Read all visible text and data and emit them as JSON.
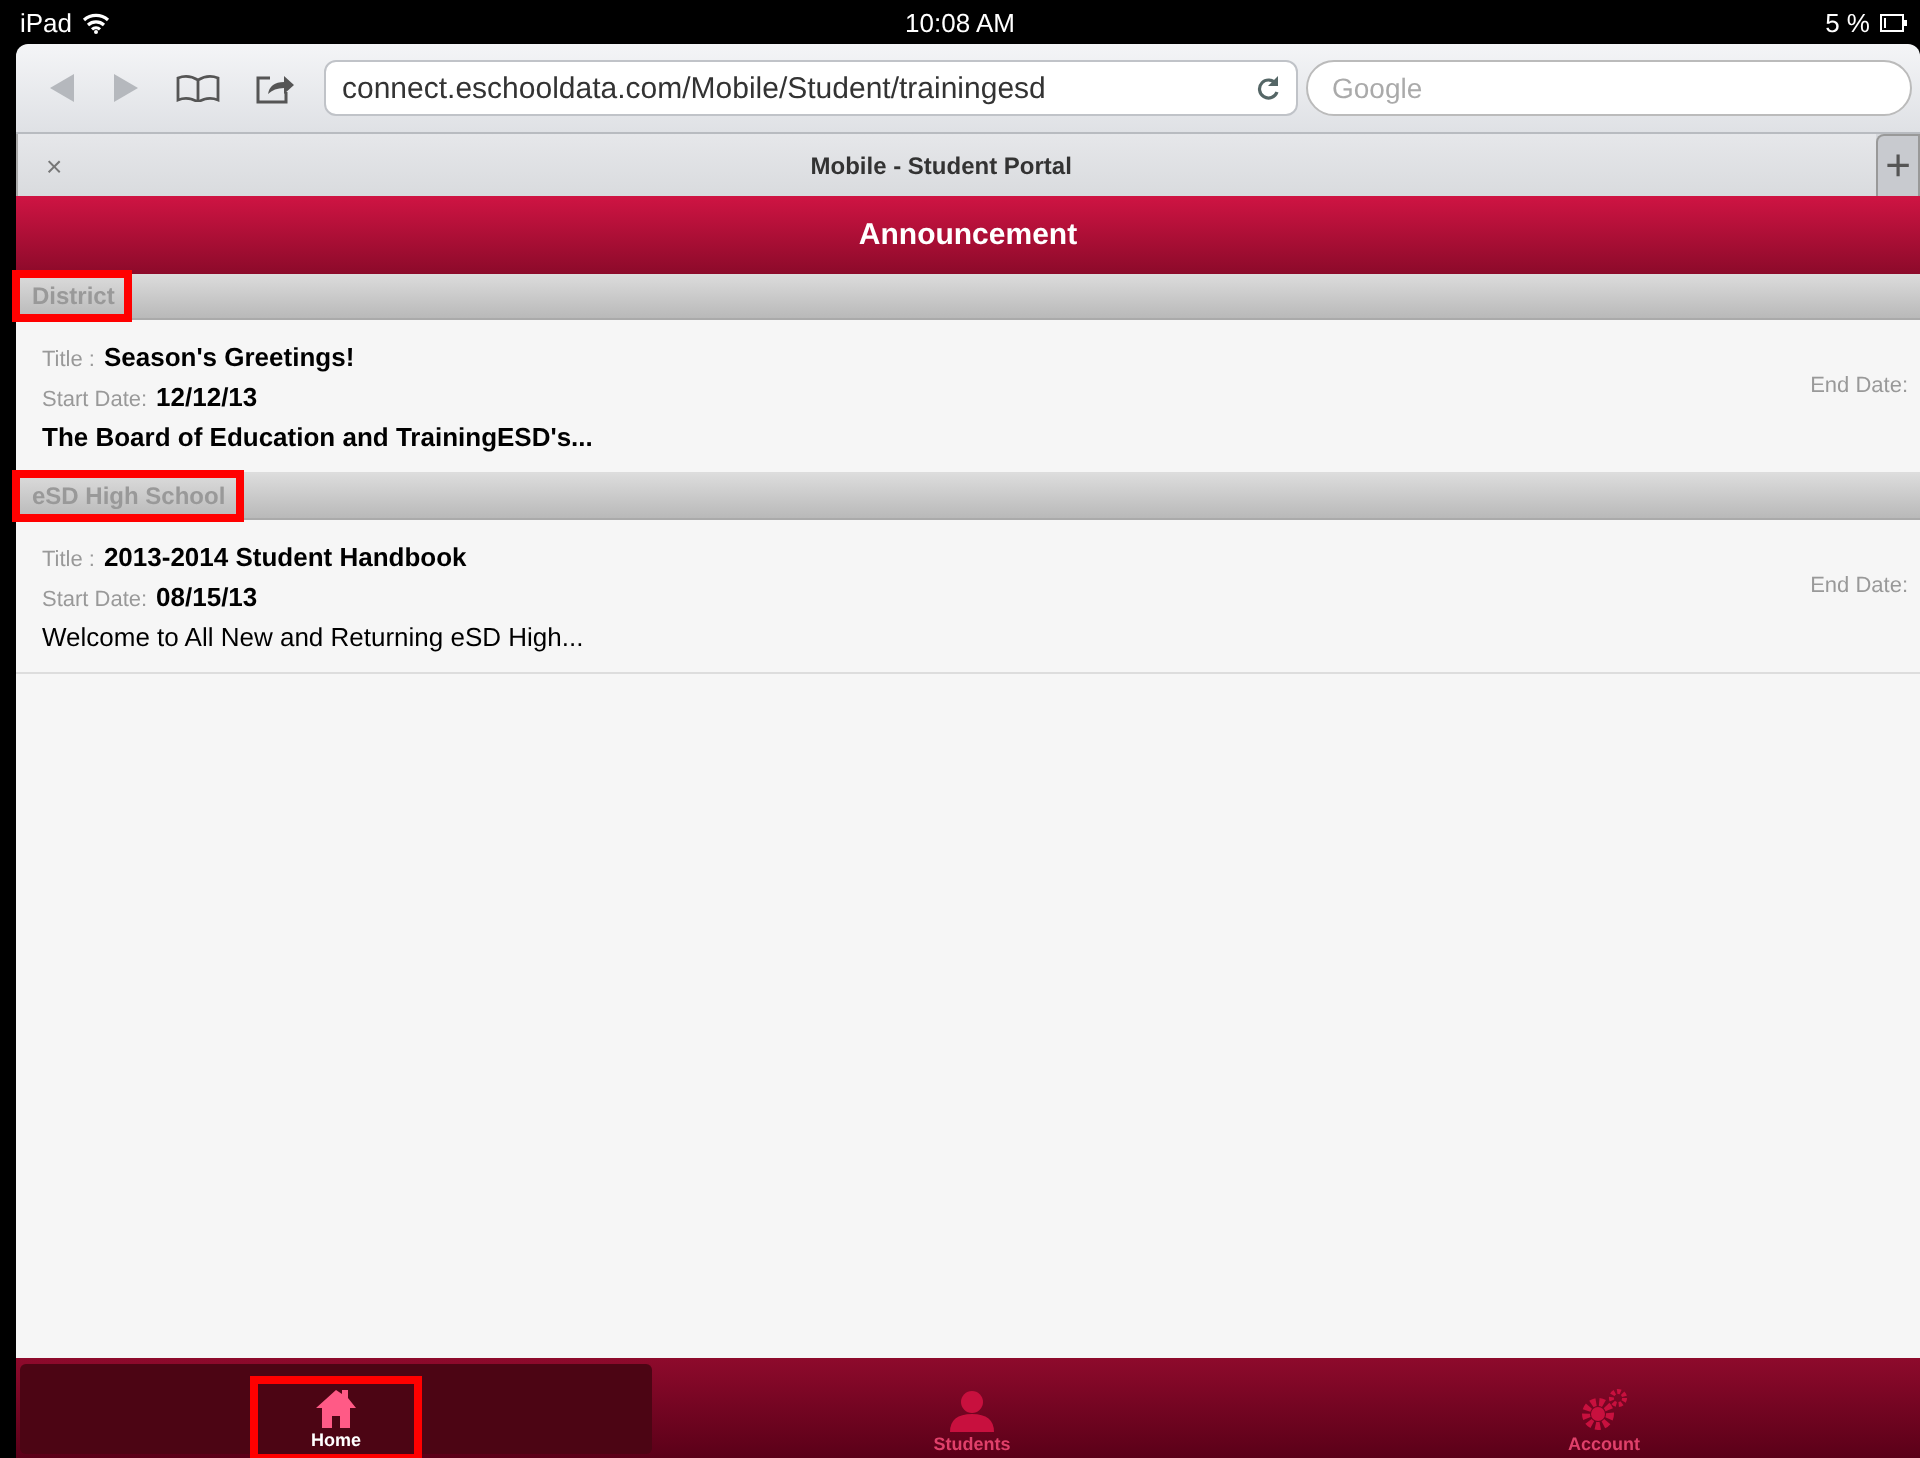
{
  "status_bar": {
    "device": "iPad",
    "time": "10:08 AM",
    "battery": "5 %"
  },
  "browser": {
    "url": "connect.eschooldata.com/Mobile/Student/trainingesd",
    "search": {
      "placeholder": "Google"
    },
    "tab_close": "×",
    "tab_title": "Mobile - Student Portal",
    "new_tab": "+"
  },
  "header": {
    "title": "Announcement"
  },
  "sections": [
    {
      "name": "District",
      "highlighted": true,
      "items": [
        {
          "title_label": "Title :",
          "title": "Season's Greetings!",
          "start_label": "Start Date:",
          "start_date": "12/12/13",
          "end_label": "End Date:",
          "summary": "The Board of Education and TrainingESD's...",
          "summary_bold": true
        }
      ]
    },
    {
      "name": "eSD High School",
      "highlighted": true,
      "items": [
        {
          "title_label": "Title :",
          "title": "2013-2014 Student Handbook",
          "start_label": "Start Date:",
          "start_date": "08/15/13",
          "end_label": "End Date:",
          "summary": "Welcome to All New and Returning eSD High...",
          "summary_bold": false
        }
      ]
    }
  ],
  "tab_bar": [
    {
      "kind": "home",
      "label": "Home",
      "selected": true,
      "highlighted": true
    },
    {
      "kind": "students",
      "label": "Students",
      "selected": false,
      "highlighted": false
    },
    {
      "kind": "account",
      "label": "Account",
      "selected": false,
      "highlighted": false
    }
  ]
}
